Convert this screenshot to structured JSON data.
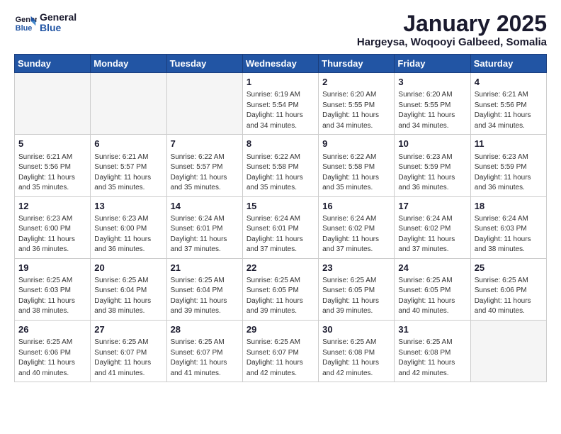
{
  "logo": {
    "line1": "General",
    "line2": "Blue"
  },
  "title": "January 2025",
  "subtitle": "Hargeysa, Woqooyi Galbeed, Somalia",
  "days_header": [
    "Sunday",
    "Monday",
    "Tuesday",
    "Wednesday",
    "Thursday",
    "Friday",
    "Saturday"
  ],
  "weeks": [
    [
      {
        "day": "",
        "info": ""
      },
      {
        "day": "",
        "info": ""
      },
      {
        "day": "",
        "info": ""
      },
      {
        "day": "1",
        "info": "Sunrise: 6:19 AM\nSunset: 5:54 PM\nDaylight: 11 hours and 34 minutes."
      },
      {
        "day": "2",
        "info": "Sunrise: 6:20 AM\nSunset: 5:55 PM\nDaylight: 11 hours and 34 minutes."
      },
      {
        "day": "3",
        "info": "Sunrise: 6:20 AM\nSunset: 5:55 PM\nDaylight: 11 hours and 34 minutes."
      },
      {
        "day": "4",
        "info": "Sunrise: 6:21 AM\nSunset: 5:56 PM\nDaylight: 11 hours and 34 minutes."
      }
    ],
    [
      {
        "day": "5",
        "info": "Sunrise: 6:21 AM\nSunset: 5:56 PM\nDaylight: 11 hours and 35 minutes."
      },
      {
        "day": "6",
        "info": "Sunrise: 6:21 AM\nSunset: 5:57 PM\nDaylight: 11 hours and 35 minutes."
      },
      {
        "day": "7",
        "info": "Sunrise: 6:22 AM\nSunset: 5:57 PM\nDaylight: 11 hours and 35 minutes."
      },
      {
        "day": "8",
        "info": "Sunrise: 6:22 AM\nSunset: 5:58 PM\nDaylight: 11 hours and 35 minutes."
      },
      {
        "day": "9",
        "info": "Sunrise: 6:22 AM\nSunset: 5:58 PM\nDaylight: 11 hours and 35 minutes."
      },
      {
        "day": "10",
        "info": "Sunrise: 6:23 AM\nSunset: 5:59 PM\nDaylight: 11 hours and 36 minutes."
      },
      {
        "day": "11",
        "info": "Sunrise: 6:23 AM\nSunset: 5:59 PM\nDaylight: 11 hours and 36 minutes."
      }
    ],
    [
      {
        "day": "12",
        "info": "Sunrise: 6:23 AM\nSunset: 6:00 PM\nDaylight: 11 hours and 36 minutes."
      },
      {
        "day": "13",
        "info": "Sunrise: 6:23 AM\nSunset: 6:00 PM\nDaylight: 11 hours and 36 minutes."
      },
      {
        "day": "14",
        "info": "Sunrise: 6:24 AM\nSunset: 6:01 PM\nDaylight: 11 hours and 37 minutes."
      },
      {
        "day": "15",
        "info": "Sunrise: 6:24 AM\nSunset: 6:01 PM\nDaylight: 11 hours and 37 minutes."
      },
      {
        "day": "16",
        "info": "Sunrise: 6:24 AM\nSunset: 6:02 PM\nDaylight: 11 hours and 37 minutes."
      },
      {
        "day": "17",
        "info": "Sunrise: 6:24 AM\nSunset: 6:02 PM\nDaylight: 11 hours and 37 minutes."
      },
      {
        "day": "18",
        "info": "Sunrise: 6:24 AM\nSunset: 6:03 PM\nDaylight: 11 hours and 38 minutes."
      }
    ],
    [
      {
        "day": "19",
        "info": "Sunrise: 6:25 AM\nSunset: 6:03 PM\nDaylight: 11 hours and 38 minutes."
      },
      {
        "day": "20",
        "info": "Sunrise: 6:25 AM\nSunset: 6:04 PM\nDaylight: 11 hours and 38 minutes."
      },
      {
        "day": "21",
        "info": "Sunrise: 6:25 AM\nSunset: 6:04 PM\nDaylight: 11 hours and 39 minutes."
      },
      {
        "day": "22",
        "info": "Sunrise: 6:25 AM\nSunset: 6:05 PM\nDaylight: 11 hours and 39 minutes."
      },
      {
        "day": "23",
        "info": "Sunrise: 6:25 AM\nSunset: 6:05 PM\nDaylight: 11 hours and 39 minutes."
      },
      {
        "day": "24",
        "info": "Sunrise: 6:25 AM\nSunset: 6:05 PM\nDaylight: 11 hours and 40 minutes."
      },
      {
        "day": "25",
        "info": "Sunrise: 6:25 AM\nSunset: 6:06 PM\nDaylight: 11 hours and 40 minutes."
      }
    ],
    [
      {
        "day": "26",
        "info": "Sunrise: 6:25 AM\nSunset: 6:06 PM\nDaylight: 11 hours and 40 minutes."
      },
      {
        "day": "27",
        "info": "Sunrise: 6:25 AM\nSunset: 6:07 PM\nDaylight: 11 hours and 41 minutes."
      },
      {
        "day": "28",
        "info": "Sunrise: 6:25 AM\nSunset: 6:07 PM\nDaylight: 11 hours and 41 minutes."
      },
      {
        "day": "29",
        "info": "Sunrise: 6:25 AM\nSunset: 6:07 PM\nDaylight: 11 hours and 42 minutes."
      },
      {
        "day": "30",
        "info": "Sunrise: 6:25 AM\nSunset: 6:08 PM\nDaylight: 11 hours and 42 minutes."
      },
      {
        "day": "31",
        "info": "Sunrise: 6:25 AM\nSunset: 6:08 PM\nDaylight: 11 hours and 42 minutes."
      },
      {
        "day": "",
        "info": ""
      }
    ]
  ]
}
